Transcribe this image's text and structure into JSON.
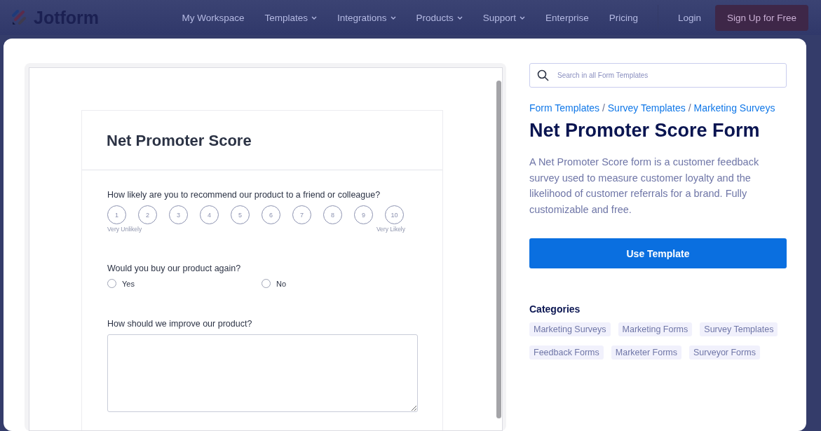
{
  "header": {
    "logo": "Jotform",
    "nav": [
      {
        "label": "My Workspace",
        "dropdown": false
      },
      {
        "label": "Templates",
        "dropdown": true
      },
      {
        "label": "Integrations",
        "dropdown": true
      },
      {
        "label": "Products",
        "dropdown": true
      },
      {
        "label": "Support",
        "dropdown": true
      },
      {
        "label": "Enterprise",
        "dropdown": false
      },
      {
        "label": "Pricing",
        "dropdown": false
      }
    ],
    "login": "Login",
    "signup": "Sign Up for Free"
  },
  "preview": {
    "form_title": "Net Promoter Score",
    "questions": [
      {
        "kind": "scale",
        "label": "How likely are you to recommend our product to a friend or colleague?",
        "options": [
          "1",
          "2",
          "3",
          "4",
          "5",
          "6",
          "7",
          "8",
          "9",
          "10"
        ],
        "low_label": "Very Unlikely",
        "high_label": "Very Likely"
      },
      {
        "kind": "radio",
        "label": "Would you buy our product again?",
        "options": [
          {
            "label": "Yes",
            "selected": false
          },
          {
            "label": "No",
            "selected": false
          }
        ]
      },
      {
        "kind": "textarea",
        "label": "How should we improve our product?"
      }
    ]
  },
  "search": {
    "placeholder": "Search in all Form Templates"
  },
  "breadcrumbs": {
    "separator": "/",
    "items": [
      "Form Templates",
      "Survey Templates",
      "Marketing Surveys"
    ]
  },
  "title": "Net Promoter Score Form",
  "description": "A Net Promoter Score form is a customer feedback survey used to measure customer loyalty and the likelihood of customer referrals for a brand. Fully customizable and free.",
  "use_button": "Use Template",
  "categories": {
    "heading": "Categories",
    "tags": [
      "Marketing Surveys",
      "Marketing Forms",
      "Survey Templates",
      "Feedback Forms",
      "Marketer Forms",
      "Surveyor Forms"
    ]
  }
}
